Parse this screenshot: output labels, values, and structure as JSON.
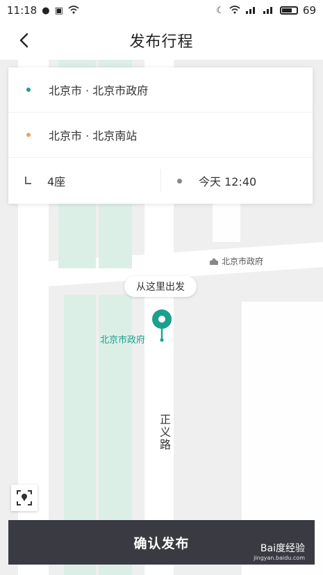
{
  "status_bar": {
    "time": "11:18",
    "battery": "69",
    "left_icons": [
      "chat-icon",
      "image-icon",
      "wifi-icon"
    ],
    "right_icons": [
      "wifi-icon",
      "signal-icon",
      "signal-icon",
      "battery-icon"
    ]
  },
  "header": {
    "title": "发布行程"
  },
  "trip": {
    "start": "北京市 · 北京市政府",
    "end": "北京市 · 北京南站",
    "seats": "4座",
    "time": "今天 12:40"
  },
  "map": {
    "poi_label": "北京市政府",
    "bubble_text": "从这里出发",
    "pin_label": "北京市政府",
    "road_name": "正义路"
  },
  "footer": {
    "confirm_label": "确认发布"
  },
  "watermark": {
    "brand": "Bai度经验",
    "url": "jingyan.baidu.com"
  },
  "colors": {
    "accent_green": "#1aa08c",
    "accent_orange": "#f0a060",
    "button_dark": "#3a3b42"
  }
}
